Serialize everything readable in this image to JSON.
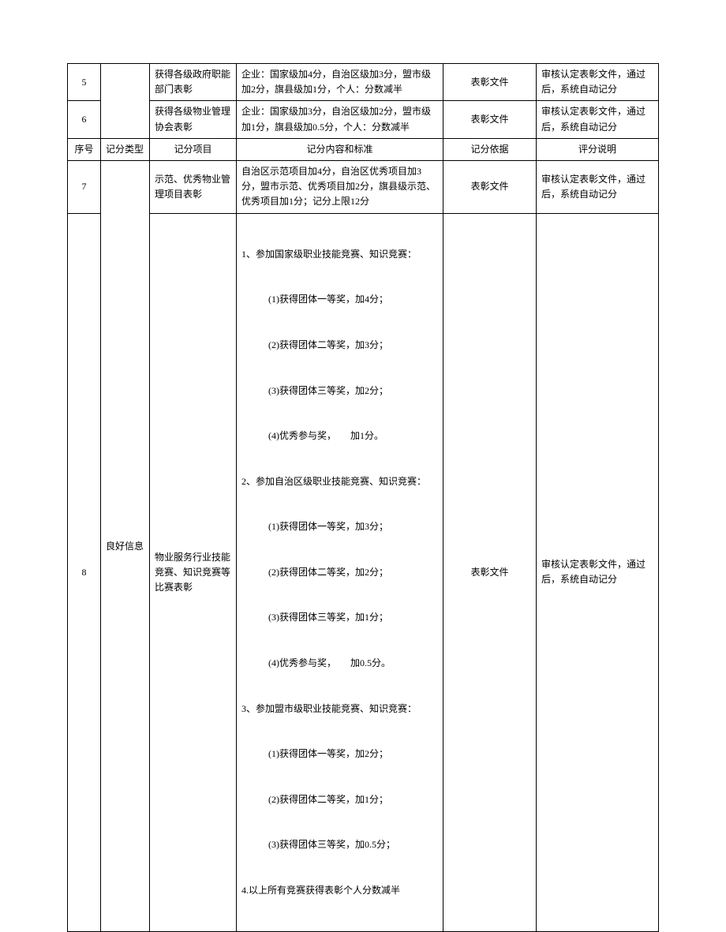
{
  "header": {
    "idx": "序号",
    "type": "记分类型",
    "item": "记分项目",
    "content": "记分内容和标准",
    "basis": "记分依据",
    "note": "评分说明"
  },
  "category": "良好信息",
  "rows": {
    "r5": {
      "idx": "5",
      "item": "获得各级政府职能部门表彰",
      "content": "企业：国家级加4分，自治区级加3分，盟市级加2分，旗县级加1分，个人：分数减半",
      "basis": "表彰文件",
      "note": "审核认定表彰文件，通过后，系统自动记分"
    },
    "r6": {
      "idx": "6",
      "item": "获得各级物业管理协会表彰",
      "content": "企业：国家级加3分，自治区级加2分，盟市级加1分，旗县级加0.5分，个人：分数减半",
      "basis": "表彰文件",
      "note": "审核认定表彰文件，通过后，系统自动记分"
    },
    "r7": {
      "idx": "7",
      "item": "示范、优秀物业管理项目表彰",
      "content": "自治区示范项目加4分，自治区优秀项目加3分，盟市示范、优秀项目加2分，旗县级示范、优秀项目加1分；记分上限12分",
      "basis": "表彰文件",
      "note": "审核认定表彰文件，通过后，系统自动记分"
    },
    "r8": {
      "idx": "8",
      "item": "物业服务行业技能竞赛、知识竞赛等比赛表彰",
      "basis": "表彰文件",
      "note": "审核认定表彰文件，通过后，系统自动记分",
      "lines": {
        "g1": "1、参加国家级职业技能竞赛、知识竞赛：",
        "g1a": "(1)获得团体一等奖，加4分；",
        "g1b": "(2)获得团体二等奖，加3分；",
        "g1c": "(3)获得团体三等奖，加2分；",
        "g1d": "(4)优秀参与奖，　　加1分。",
        "g2": "2、参加自治区级职业技能竞赛、知识竞赛：",
        "g2a": "(1)获得团体一等奖，加3分；",
        "g2b": "(2)获得团体二等奖，加2分；",
        "g2c": "(3)获得团体三等奖，加1分；",
        "g2d": "(4)优秀参与奖，　　加0.5分。",
        "g3": "3、参加盟市级职业技能竞赛、知识竞赛：",
        "g3a": "(1)获得团体一等奖，加2分；",
        "g3b": "(2)获得团体二等奖，加1分；",
        "g3c": "(3)获得团体三等奖，加0.5分；",
        "g4": "4.以上所有竞赛获得表彰个人分数减半"
      }
    }
  }
}
